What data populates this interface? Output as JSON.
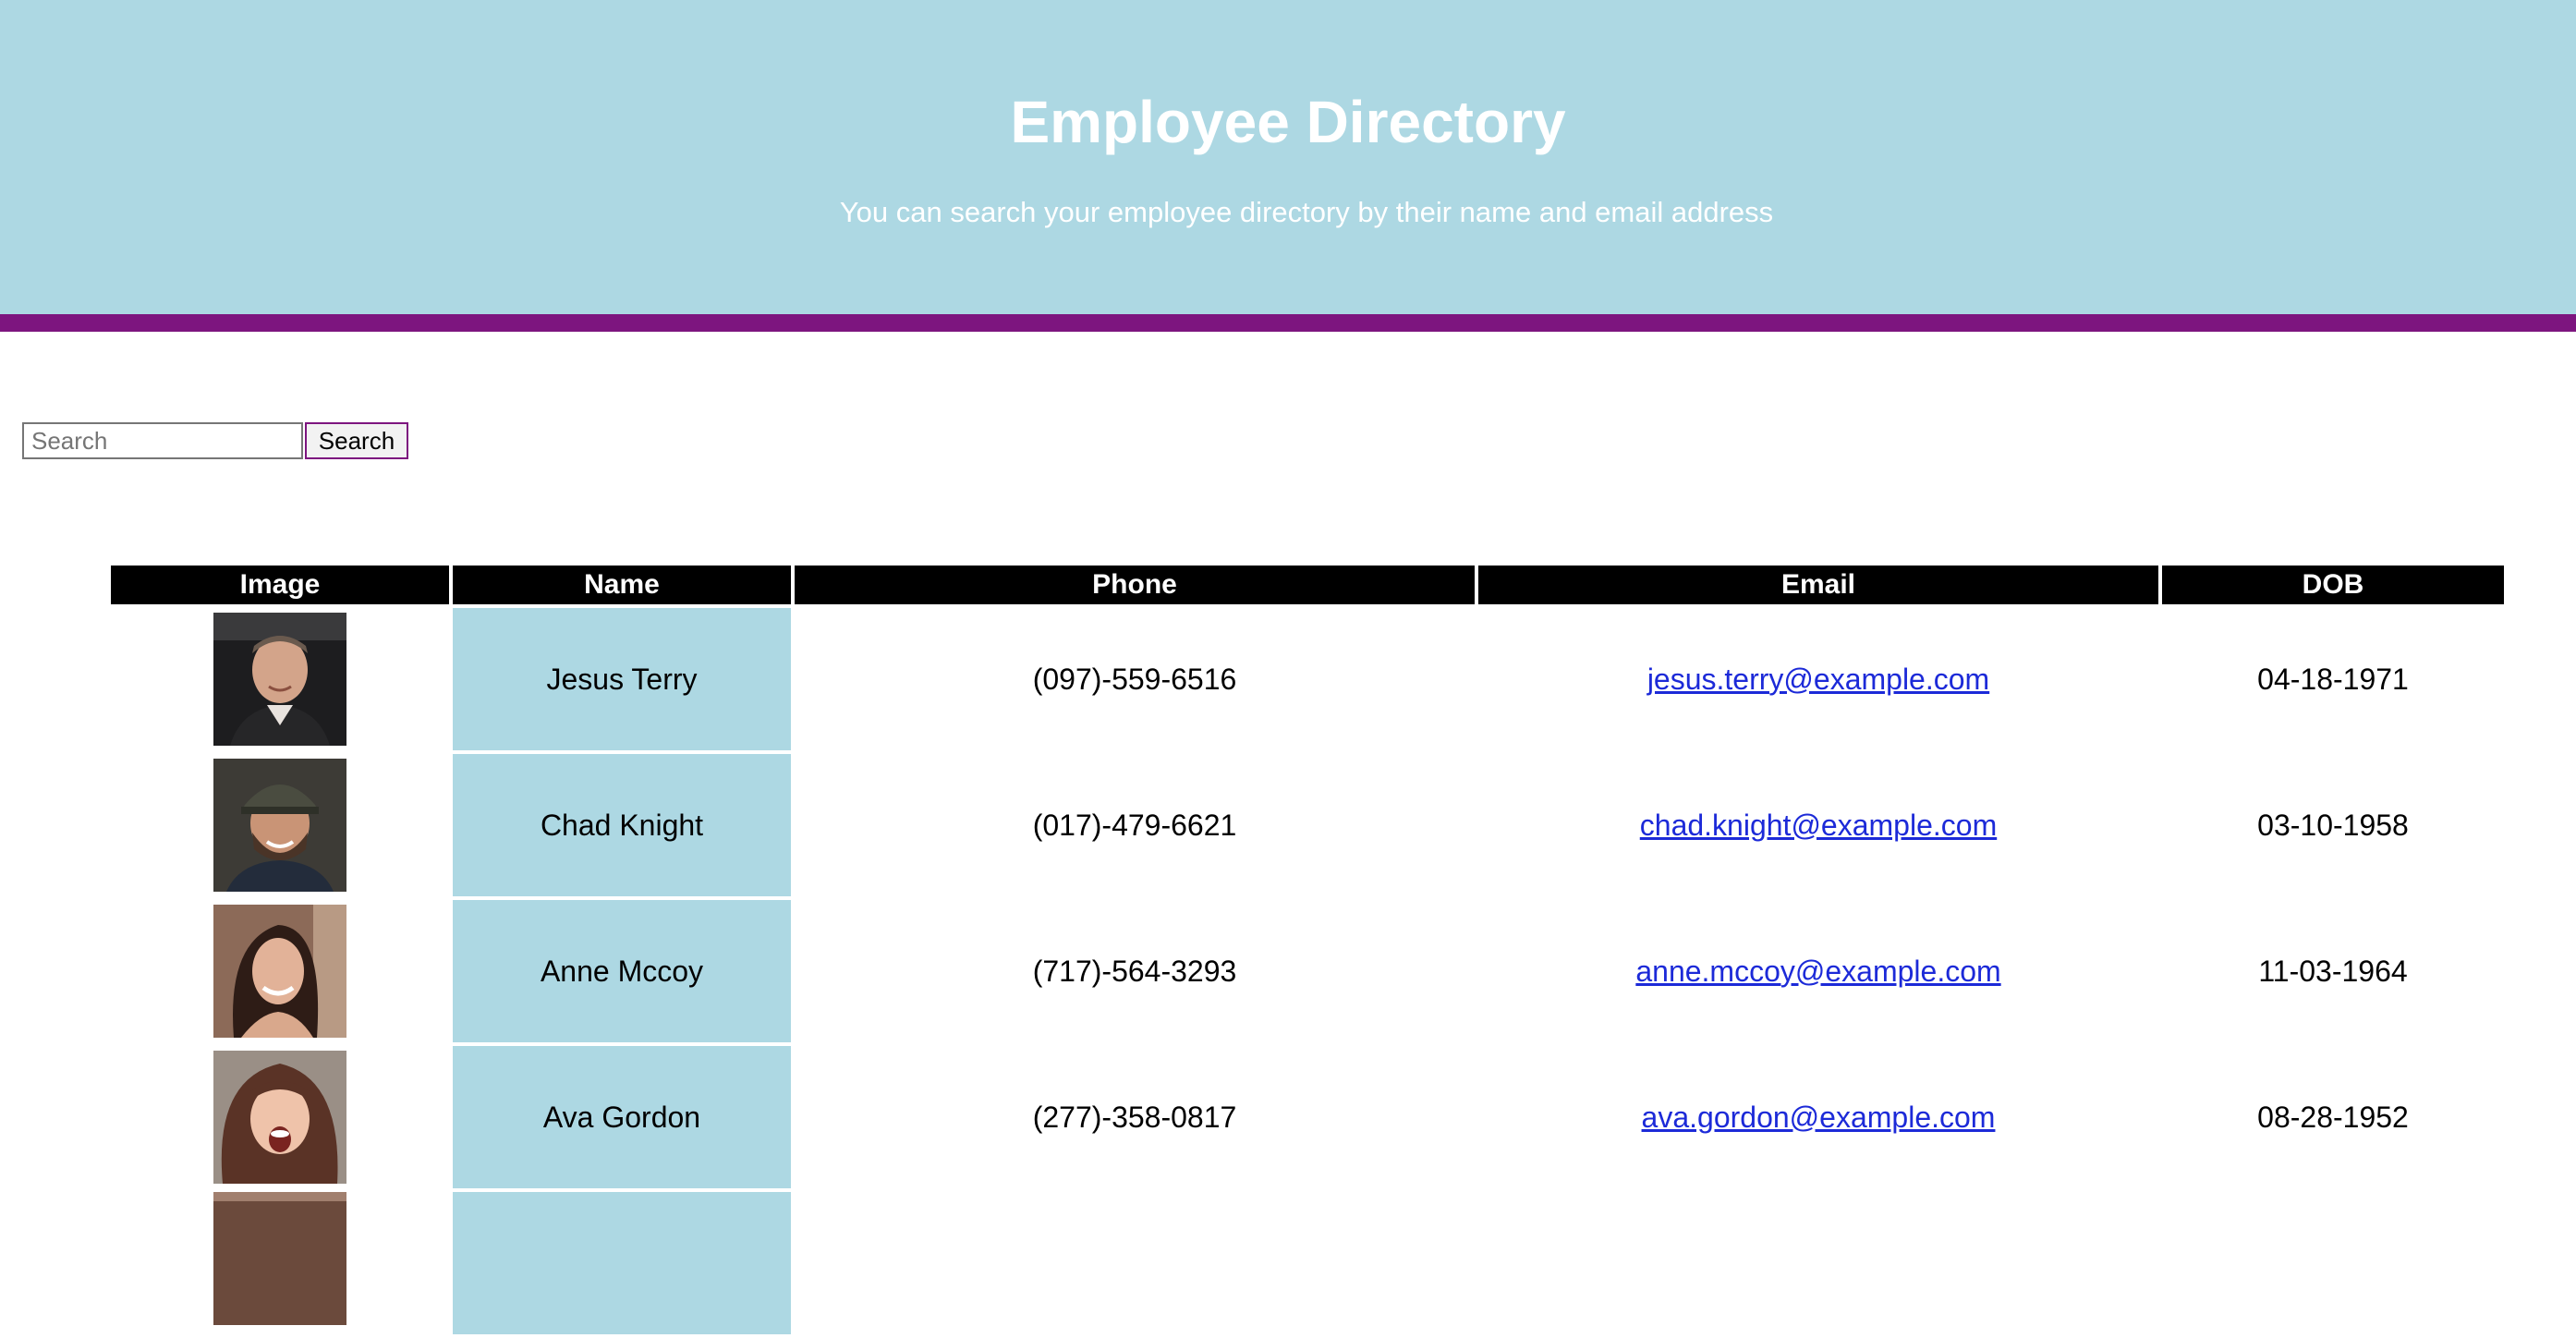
{
  "header": {
    "title": "Employee Directory",
    "subtitle": "You can search your employee directory by their name and email address"
  },
  "search": {
    "placeholder": "Search",
    "value": "",
    "button_label": "Search"
  },
  "table": {
    "columns": [
      "Image",
      "Name",
      "Phone",
      "Email",
      "DOB"
    ],
    "rows": [
      {
        "name": "Jesus Terry",
        "phone": "(097)-559-6516",
        "email": "jesus.terry@example.com",
        "dob": "04-18-1971"
      },
      {
        "name": "Chad Knight",
        "phone": "(017)-479-6621",
        "email": "chad.knight@example.com",
        "dob": "03-10-1958"
      },
      {
        "name": "Anne Mccoy",
        "phone": "(717)-564-3293",
        "email": "anne.mccoy@example.com",
        "dob": "11-03-1964"
      },
      {
        "name": "Ava Gordon",
        "phone": "(277)-358-0817",
        "email": "ava.gordon@example.com",
        "dob": "08-28-1952"
      },
      {
        "name": "",
        "phone": "",
        "email": "",
        "dob": ""
      }
    ]
  },
  "colors": {
    "hero_background": "#add8e3",
    "hero_border": "#7d157f",
    "header_cell": "#000000",
    "name_cell": "#add8e3",
    "link": "#1c2ad8"
  }
}
